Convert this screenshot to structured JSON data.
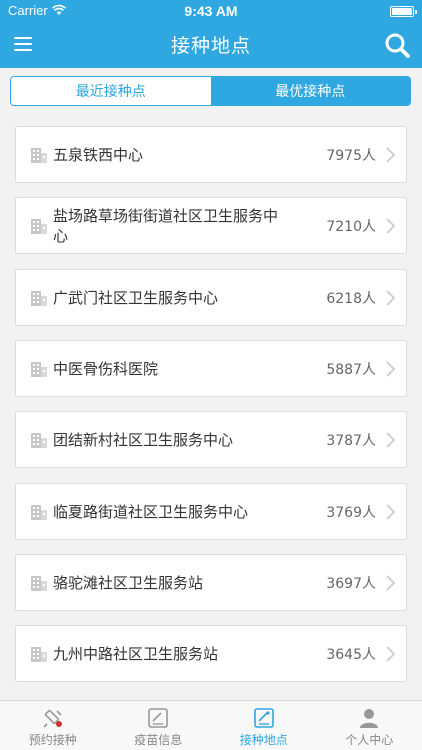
{
  "status_bar": {
    "carrier": "Carrier",
    "time": "9:43 AM"
  },
  "nav": {
    "title": "接种地点"
  },
  "segment": {
    "tabs": [
      {
        "label": "最近接种点"
      },
      {
        "label": "最优接种点"
      }
    ]
  },
  "sites": [
    {
      "name": "五泉铁西中心",
      "count": "7975人"
    },
    {
      "name": "盐场路草场街街道社区卫生服务中心",
      "count": "7210人"
    },
    {
      "name": "广武门社区卫生服务中心",
      "count": "6218人"
    },
    {
      "name": "中医骨伤科医院",
      "count": "5887人"
    },
    {
      "name": "团结新村社区卫生服务中心",
      "count": "3787人"
    },
    {
      "name": "临夏路街道社区卫生服务中心",
      "count": "3769人"
    },
    {
      "name": "骆驼滩社区卫生服务站",
      "count": "3697人"
    },
    {
      "name": "九州中路社区卫生服务站",
      "count": "3645人"
    }
  ],
  "tabbar": {
    "items": [
      {
        "label": "预约接种",
        "icon": "syringe-icon"
      },
      {
        "label": "疫苗信息",
        "icon": "vaccine-info-icon"
      },
      {
        "label": "接种地点",
        "icon": "location-board-icon"
      },
      {
        "label": "个人中心",
        "icon": "person-icon"
      }
    ]
  },
  "colors": {
    "accent": "#2fa7e1",
    "text": "#333333",
    "muted": "#888888"
  }
}
